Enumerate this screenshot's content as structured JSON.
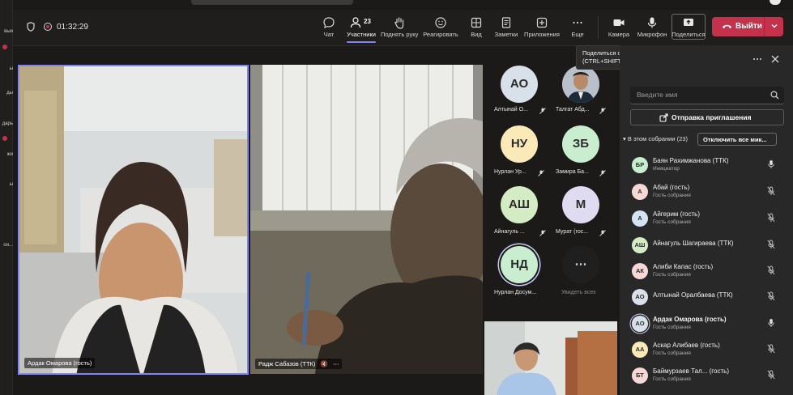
{
  "rail": {
    "items": [
      "вый",
      "ы",
      "ды",
      "дарь",
      "жи",
      "ы",
      "ои..."
    ]
  },
  "toolbar": {
    "timer": "01:32:29",
    "chat": "Чат",
    "participants": "Участники",
    "participants_count": "23",
    "raise_hand": "Поднять руку",
    "react": "Реагировать",
    "view": "Вид",
    "notes": "Заметки",
    "apps": "Приложения",
    "more": "Еще",
    "camera": "Камера",
    "mic": "Микрофон",
    "share": "Поделиться",
    "leave": "Выйти"
  },
  "tooltip": {
    "line1": "Поделиться содержимым",
    "line2": "(CTRL+SHIFT+E)"
  },
  "stage": {
    "tile1_name": "Ардак Омарова (гость)",
    "tile2_name": "Радж Сабазов (ТТК)"
  },
  "grid": [
    {
      "initials": "АО",
      "name": "Алтынай О...",
      "color": "#d8e0ea"
    },
    {
      "initials": "",
      "name": "Талгат Абд...",
      "color": "#8a8a8a"
    },
    {
      "initials": "НУ",
      "name": "Нурлан Ур...",
      "color": "#fbe9b7"
    },
    {
      "initials": "ЗБ",
      "name": "Замира Ба...",
      "color": "#c9eecf"
    },
    {
      "initials": "АШ",
      "name": "Айнагуль ...",
      "color": "#d4ecc4"
    },
    {
      "initials": "М",
      "name": "Мурат (гос...",
      "color": "#dfdcf2"
    },
    {
      "initials": "НД",
      "name": "Нурлан Досум...",
      "color": "#c9eecf"
    },
    {
      "initials": "⋯",
      "name": "Увидеть всех",
      "color": "#1f1f1f"
    }
  ],
  "panel": {
    "search_placeholder": "Введите имя",
    "invite": "Отправка приглашения",
    "section": "В этом собрании (23)",
    "mute_all": "Отключить все мик...",
    "participants": [
      {
        "initials": "БР",
        "name": "Баян Рахимжанова (ТТК)",
        "role": "Инициатор",
        "color": "#c9eecf"
      },
      {
        "initials": "А",
        "name": "Абай (гость)",
        "role": "Гость собрания",
        "color": "#f8d7d7"
      },
      {
        "initials": "А",
        "name": "Айгерим (гость)",
        "role": "Гость собрания",
        "color": "#d5e4f5"
      },
      {
        "initials": "АШ",
        "name": "Айнагуль Шагираева (ТТК)",
        "role": "",
        "color": "#d4ecc4"
      },
      {
        "initials": "АК",
        "name": "Алиби Капас (гость)",
        "role": "Гость собрания",
        "color": "#f8d7d7"
      },
      {
        "initials": "АО",
        "name": "Алтынай Оралбаева (ТТК)",
        "role": "",
        "color": "#d8e0ea"
      },
      {
        "initials": "АО",
        "name": "Ардак Омарова (гость)",
        "role": "Гость собрания",
        "color": "#d8e0ea"
      },
      {
        "initials": "АА",
        "name": "Аскар Алибаев (гость)",
        "role": "Гость собрания",
        "color": "#fbe9b7"
      },
      {
        "initials": "БТ",
        "name": "Баймурзаев Тал...",
        "role": "Гость собрания",
        "color": "#f8d7d7"
      }
    ],
    "extra_name_suffix": "(гость)"
  }
}
